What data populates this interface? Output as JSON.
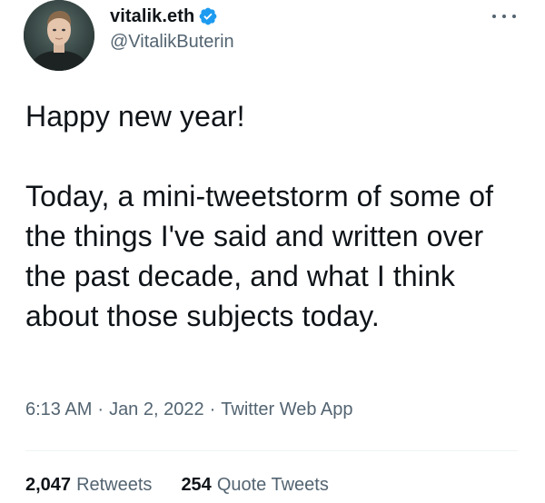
{
  "author": {
    "display_name": "vitalik.eth",
    "handle": "@VitalikButerin",
    "verified_icon": "verified-badge-icon",
    "avatar_icon": "avatar"
  },
  "tweet": {
    "text": "Happy new year!\n\nToday, a mini-tweetstorm of some of the things I've said and written over the past decade, and what I think about those subjects today."
  },
  "meta": {
    "time": "6:13 AM",
    "separator_1": "·",
    "date": "Jan 2, 2022",
    "separator_2": "·",
    "source": "Twitter Web App"
  },
  "stats": {
    "retweets_count": "2,047",
    "retweets_label": "Retweets",
    "quotes_count": "254",
    "quotes_label": "Quote Tweets"
  },
  "colors": {
    "text_primary": "#0f1419",
    "text_secondary": "#536471",
    "verified_blue": "#1d9bf0",
    "divider": "#eff3f4"
  }
}
